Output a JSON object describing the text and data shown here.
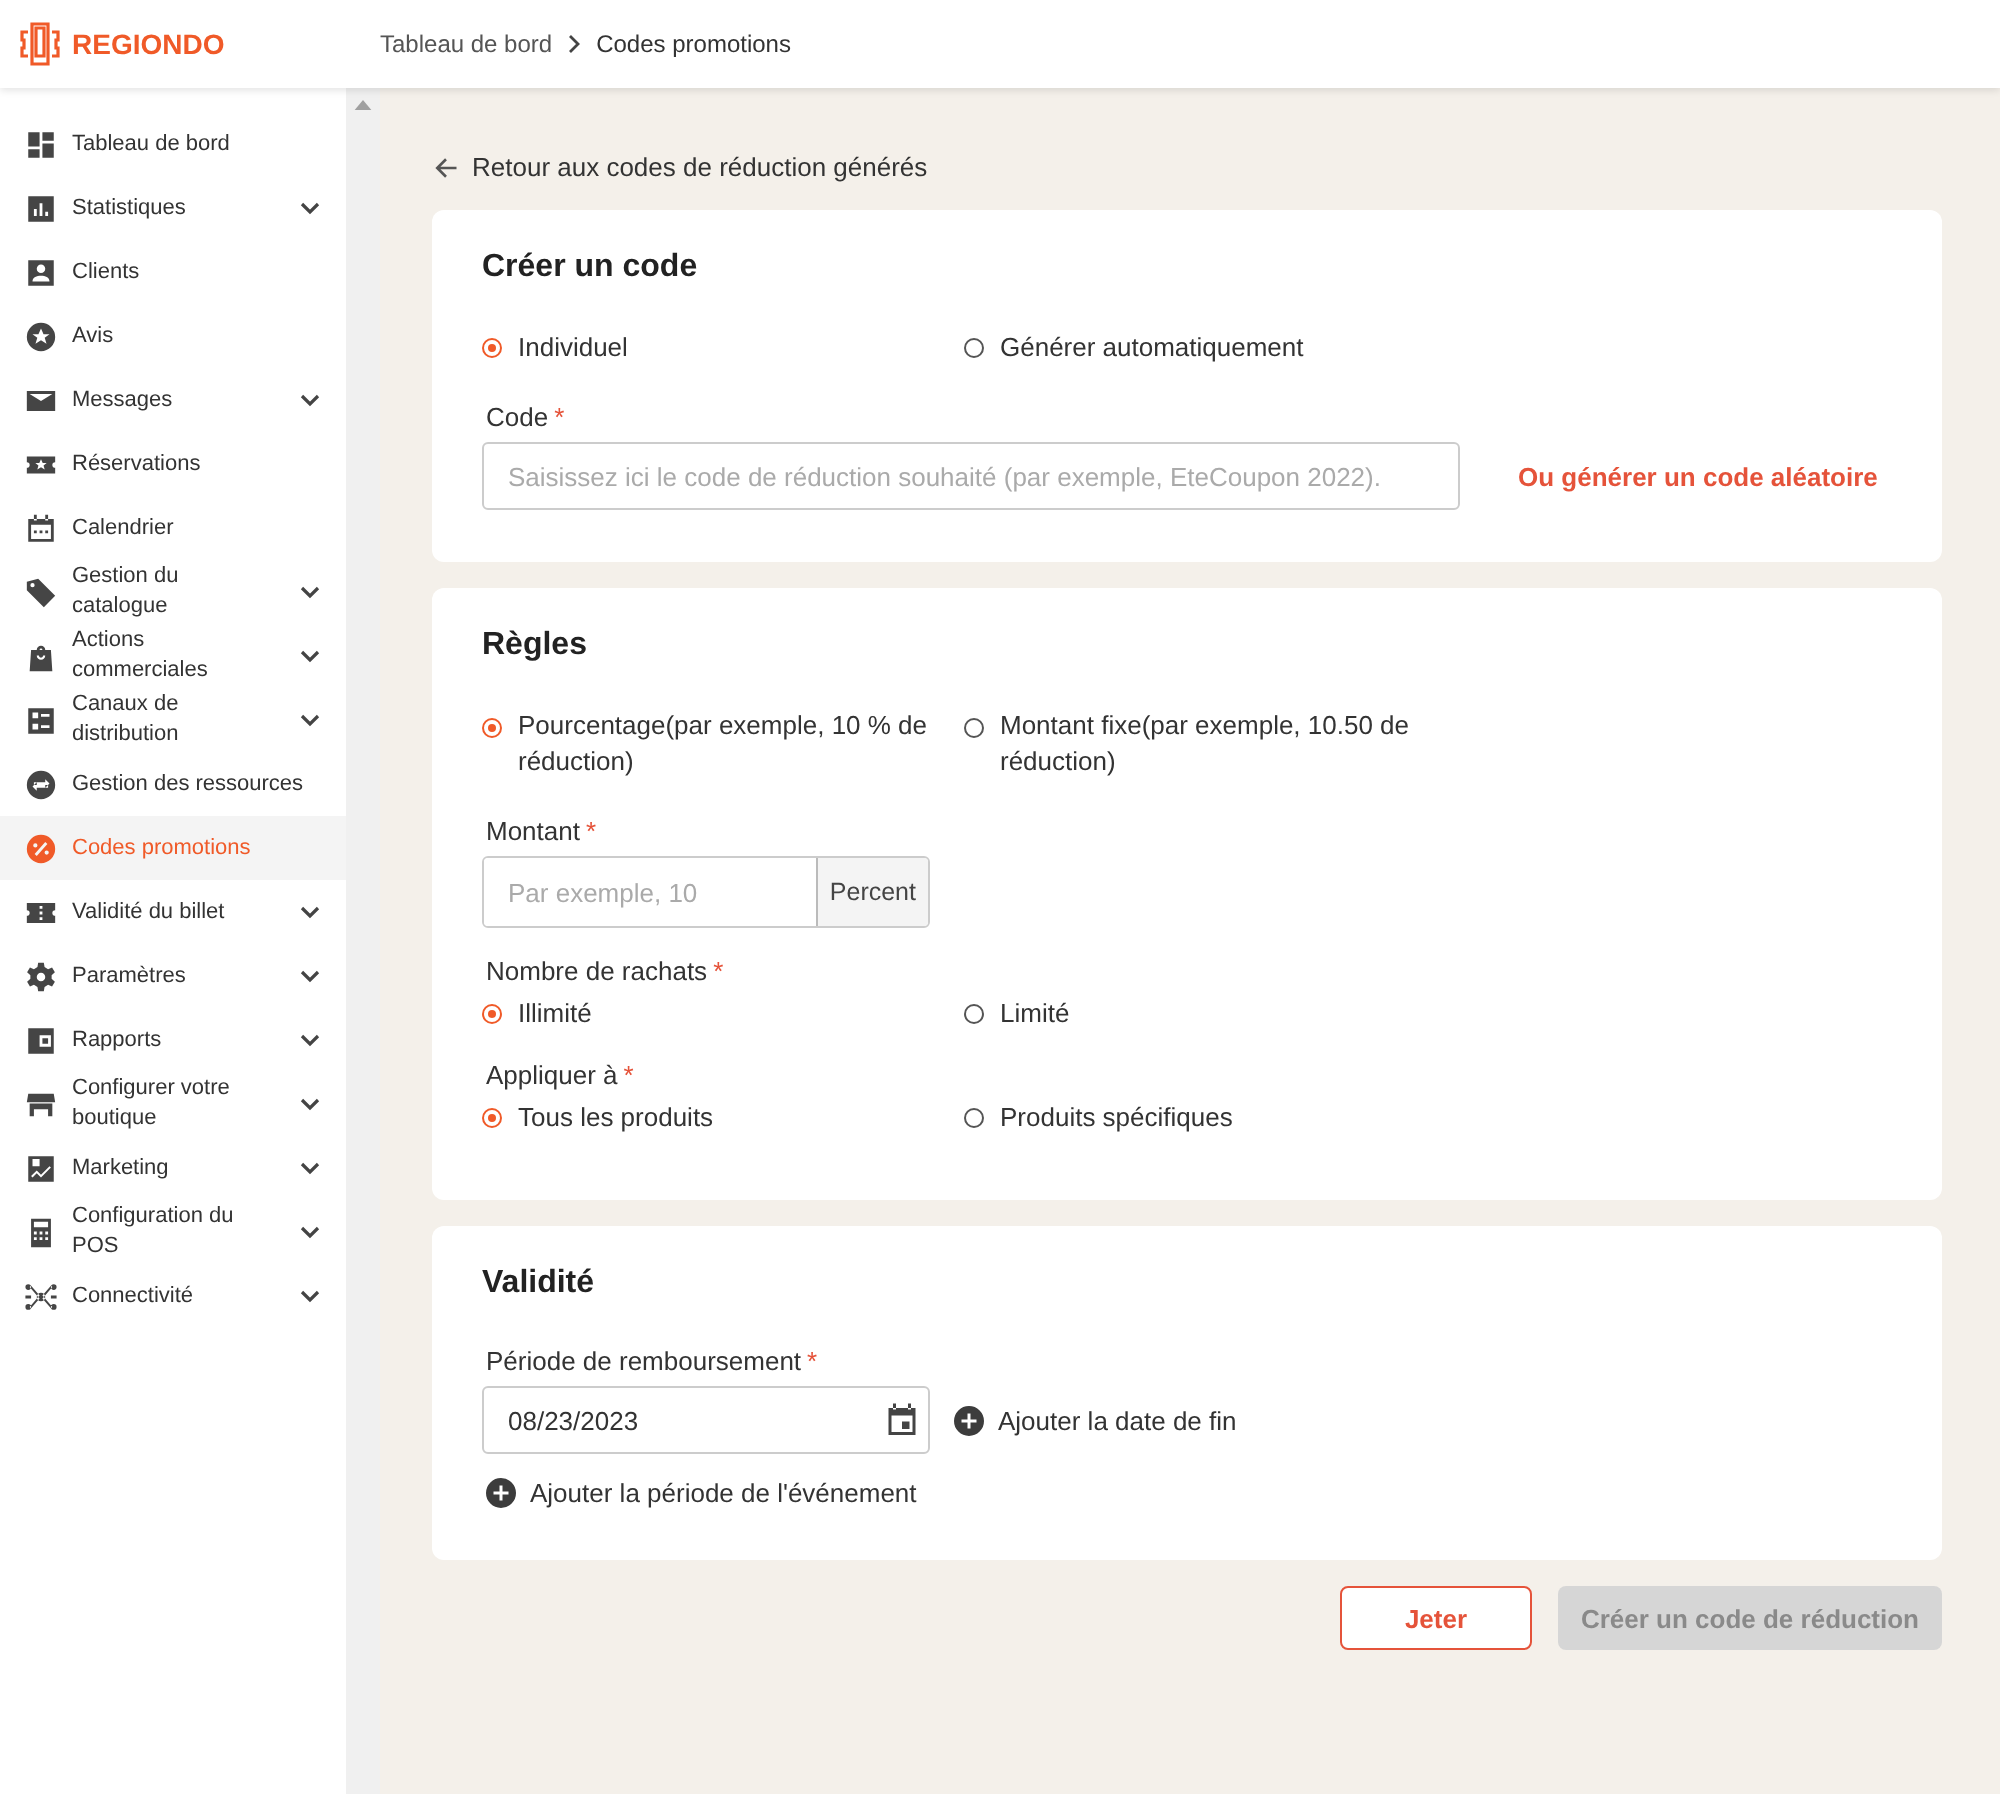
{
  "brand": {
    "name": "REGIONDO"
  },
  "breadcrumb": [
    "Tableau de bord",
    "Codes promotions"
  ],
  "sidebar": {
    "items": [
      {
        "label": "Tableau de bord",
        "selected": false,
        "expandable": false
      },
      {
        "label": "Statistiques",
        "selected": false,
        "expandable": true
      },
      {
        "label": "Clients",
        "selected": false,
        "expandable": false
      },
      {
        "label": "Avis",
        "selected": false,
        "expandable": false
      },
      {
        "label": "Messages",
        "selected": false,
        "expandable": true
      },
      {
        "label": "Réservations",
        "selected": false,
        "expandable": false
      },
      {
        "label": "Calendrier",
        "selected": false,
        "expandable": false
      },
      {
        "label": "Gestion du catalogue",
        "selected": false,
        "expandable": true
      },
      {
        "label": "Actions commerciales",
        "selected": false,
        "expandable": true
      },
      {
        "label": "Canaux de distribution",
        "selected": false,
        "expandable": true
      },
      {
        "label": "Gestion des ressources",
        "selected": false,
        "expandable": false
      },
      {
        "label": "Codes promotions",
        "selected": true,
        "expandable": false
      },
      {
        "label": "Validité du billet",
        "selected": false,
        "expandable": true
      },
      {
        "label": "Paramètres",
        "selected": false,
        "expandable": true
      },
      {
        "label": "Rapports",
        "selected": false,
        "expandable": true
      },
      {
        "label": "Configurer votre boutique",
        "selected": false,
        "expandable": true
      },
      {
        "label": "Marketing",
        "selected": false,
        "expandable": true
      },
      {
        "label": "Configuration du POS",
        "selected": false,
        "expandable": true
      },
      {
        "label": "Connectivité",
        "selected": false,
        "expandable": true
      }
    ]
  },
  "back_link": "Retour aux codes de réduction générés",
  "create_card": {
    "title": "Créer un code",
    "options": [
      {
        "label": "Individuel",
        "selected": true
      },
      {
        "label": "Générer automatiquement",
        "selected": false
      }
    ],
    "code_field": {
      "label": "Code",
      "required_mark": "*",
      "placeholder": "Saisissez ici le code de réduction souhaité (par exemple, EteCoupon 2022)."
    },
    "random_link": "Ou générer un code aléatoire"
  },
  "rules_card": {
    "title": "Règles",
    "type_options": [
      {
        "label": "Pourcentage(par exemple, 10 % de réduction)",
        "selected": true
      },
      {
        "label": "Montant fixe(par exemple, 10.50 de réduction)",
        "selected": false
      }
    ],
    "amount_field": {
      "label": "Montant",
      "required_mark": "*",
      "placeholder": "Par exemple, 10",
      "suffix": "Percent"
    },
    "redemptions": {
      "label": "Nombre de rachats",
      "required_mark": "*",
      "options": [
        {
          "label": "Illimité",
          "selected": true
        },
        {
          "label": "Limité",
          "selected": false
        }
      ]
    },
    "apply_to": {
      "label": "Appliquer à",
      "required_mark": "*",
      "options": [
        {
          "label": "Tous les produits",
          "selected": true
        },
        {
          "label": "Produits spécifiques",
          "selected": false
        }
      ]
    }
  },
  "validity_card": {
    "title": "Validité",
    "period_field": {
      "label": "Période de remboursement",
      "required_mark": "*",
      "value": "08/23/2023"
    },
    "add_end_date": "Ajouter la date de fin",
    "add_event_period": "Ajouter la période de l'événement"
  },
  "buttons": [
    {
      "label": "Jeter",
      "disabled": false,
      "kind": "secondary"
    },
    {
      "label": "Créer un code de réduction",
      "disabled": true,
      "kind": "primary"
    }
  ]
}
